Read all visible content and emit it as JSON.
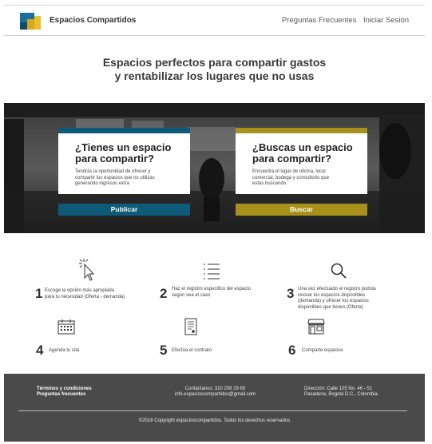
{
  "header": {
    "brand": "Espacios Compartidos",
    "nav": [
      "Preguntas Frecuentes",
      "Iniciar Sesión"
    ]
  },
  "hero": {
    "title_line1": "Espacios perfectos para compartir gastos",
    "title_line2": "y rentabilizar los lugares que no usas"
  },
  "cards": [
    {
      "title_line1": "¿Tienes un espacio",
      "title_line2": "para compartir?",
      "desc": [
        "Tendrás la oportunidad de ofrecer y",
        "compartir los espacios que no utilizas",
        "generando ingresos extra"
      ],
      "cta": "Publicar",
      "color": "#0f5a78"
    },
    {
      "title_line1": "¿Buscas un espacio",
      "title_line2": "para compartir?",
      "desc": [
        "Encuentra el lugar de oficina, local",
        "comercial, bodega y consultorio que",
        "estas buscando."
      ],
      "cta": "Buscar",
      "color": "#a8911a"
    }
  ],
  "steps": [
    {
      "num": "1",
      "lines": [
        "Escoge la opción más apropiada",
        "para tu necesidad (Oferta - demanda)"
      ],
      "icon": "cursor-click-icon"
    },
    {
      "num": "2",
      "lines": [
        "Haz el registro especifico del espacio",
        "según sea el caso"
      ],
      "icon": "list-icon"
    },
    {
      "num": "3",
      "lines": [
        "Una vez efectuado el registro podrás",
        "revisar los espacios disponibles",
        "(demanda) y ofrecer los espacios",
        "disponibles que tienes (Oferta)"
      ],
      "icon": "search-icon"
    },
    {
      "num": "4",
      "lines": [
        "Agenda tu cita"
      ],
      "icon": "calendar-icon"
    },
    {
      "num": "5",
      "lines": [
        "Efectúa el contrato"
      ],
      "icon": "contract-icon"
    },
    {
      "num": "6",
      "lines": [
        "Comparte espacios"
      ],
      "icon": "store-icon"
    }
  ],
  "footer": {
    "links": [
      "Términos y condiciones",
      "Preguntas frecuentes"
    ],
    "contact": [
      "Contáctanos:  310 208 29 69",
      "info.espacioscompartidos@gmail.com"
    ],
    "address": [
      "Dirección:  Calle 105 No. 46 - 51",
      "Pasadena, Bogotá D.C., Colombia."
    ],
    "copyright": "©2018 Copyright espacioscompartidos. Todos los derechos reservados"
  },
  "colors": {
    "blue": "#0f5a78",
    "gold": "#a8911a",
    "footer": "#4a4a4a"
  }
}
